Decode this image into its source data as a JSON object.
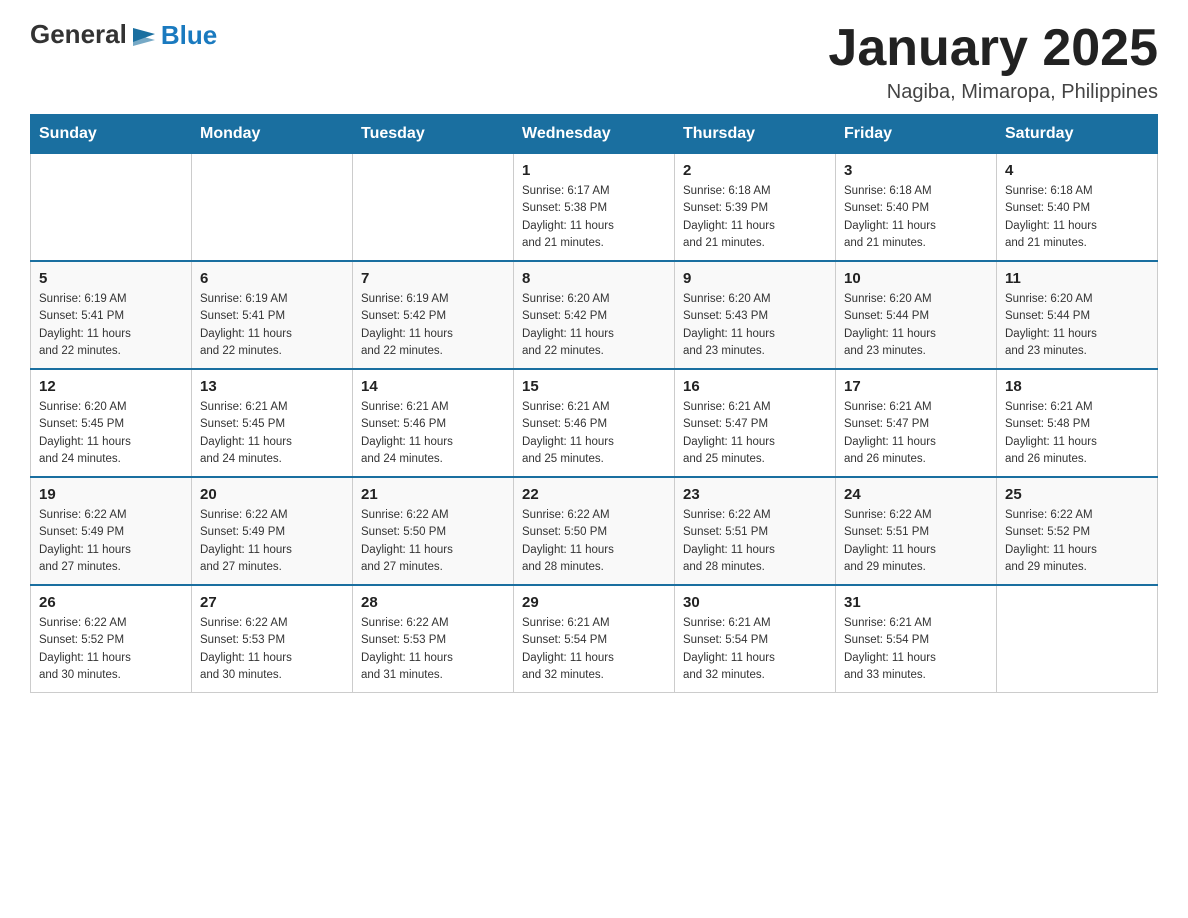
{
  "logo": {
    "text_general": "General",
    "text_blue": "Blue",
    "alt": "GeneralBlue logo"
  },
  "title": "January 2025",
  "subtitle": "Nagiba, Mimaropa, Philippines",
  "header_color": "#1a6fa0",
  "days": [
    "Sunday",
    "Monday",
    "Tuesday",
    "Wednesday",
    "Thursday",
    "Friday",
    "Saturday"
  ],
  "weeks": [
    [
      {
        "day": "",
        "info": ""
      },
      {
        "day": "",
        "info": ""
      },
      {
        "day": "",
        "info": ""
      },
      {
        "day": "1",
        "info": "Sunrise: 6:17 AM\nSunset: 5:38 PM\nDaylight: 11 hours\nand 21 minutes."
      },
      {
        "day": "2",
        "info": "Sunrise: 6:18 AM\nSunset: 5:39 PM\nDaylight: 11 hours\nand 21 minutes."
      },
      {
        "day": "3",
        "info": "Sunrise: 6:18 AM\nSunset: 5:40 PM\nDaylight: 11 hours\nand 21 minutes."
      },
      {
        "day": "4",
        "info": "Sunrise: 6:18 AM\nSunset: 5:40 PM\nDaylight: 11 hours\nand 21 minutes."
      }
    ],
    [
      {
        "day": "5",
        "info": "Sunrise: 6:19 AM\nSunset: 5:41 PM\nDaylight: 11 hours\nand 22 minutes."
      },
      {
        "day": "6",
        "info": "Sunrise: 6:19 AM\nSunset: 5:41 PM\nDaylight: 11 hours\nand 22 minutes."
      },
      {
        "day": "7",
        "info": "Sunrise: 6:19 AM\nSunset: 5:42 PM\nDaylight: 11 hours\nand 22 minutes."
      },
      {
        "day": "8",
        "info": "Sunrise: 6:20 AM\nSunset: 5:42 PM\nDaylight: 11 hours\nand 22 minutes."
      },
      {
        "day": "9",
        "info": "Sunrise: 6:20 AM\nSunset: 5:43 PM\nDaylight: 11 hours\nand 23 minutes."
      },
      {
        "day": "10",
        "info": "Sunrise: 6:20 AM\nSunset: 5:44 PM\nDaylight: 11 hours\nand 23 minutes."
      },
      {
        "day": "11",
        "info": "Sunrise: 6:20 AM\nSunset: 5:44 PM\nDaylight: 11 hours\nand 23 minutes."
      }
    ],
    [
      {
        "day": "12",
        "info": "Sunrise: 6:20 AM\nSunset: 5:45 PM\nDaylight: 11 hours\nand 24 minutes."
      },
      {
        "day": "13",
        "info": "Sunrise: 6:21 AM\nSunset: 5:45 PM\nDaylight: 11 hours\nand 24 minutes."
      },
      {
        "day": "14",
        "info": "Sunrise: 6:21 AM\nSunset: 5:46 PM\nDaylight: 11 hours\nand 24 minutes."
      },
      {
        "day": "15",
        "info": "Sunrise: 6:21 AM\nSunset: 5:46 PM\nDaylight: 11 hours\nand 25 minutes."
      },
      {
        "day": "16",
        "info": "Sunrise: 6:21 AM\nSunset: 5:47 PM\nDaylight: 11 hours\nand 25 minutes."
      },
      {
        "day": "17",
        "info": "Sunrise: 6:21 AM\nSunset: 5:47 PM\nDaylight: 11 hours\nand 26 minutes."
      },
      {
        "day": "18",
        "info": "Sunrise: 6:21 AM\nSunset: 5:48 PM\nDaylight: 11 hours\nand 26 minutes."
      }
    ],
    [
      {
        "day": "19",
        "info": "Sunrise: 6:22 AM\nSunset: 5:49 PM\nDaylight: 11 hours\nand 27 minutes."
      },
      {
        "day": "20",
        "info": "Sunrise: 6:22 AM\nSunset: 5:49 PM\nDaylight: 11 hours\nand 27 minutes."
      },
      {
        "day": "21",
        "info": "Sunrise: 6:22 AM\nSunset: 5:50 PM\nDaylight: 11 hours\nand 27 minutes."
      },
      {
        "day": "22",
        "info": "Sunrise: 6:22 AM\nSunset: 5:50 PM\nDaylight: 11 hours\nand 28 minutes."
      },
      {
        "day": "23",
        "info": "Sunrise: 6:22 AM\nSunset: 5:51 PM\nDaylight: 11 hours\nand 28 minutes."
      },
      {
        "day": "24",
        "info": "Sunrise: 6:22 AM\nSunset: 5:51 PM\nDaylight: 11 hours\nand 29 minutes."
      },
      {
        "day": "25",
        "info": "Sunrise: 6:22 AM\nSunset: 5:52 PM\nDaylight: 11 hours\nand 29 minutes."
      }
    ],
    [
      {
        "day": "26",
        "info": "Sunrise: 6:22 AM\nSunset: 5:52 PM\nDaylight: 11 hours\nand 30 minutes."
      },
      {
        "day": "27",
        "info": "Sunrise: 6:22 AM\nSunset: 5:53 PM\nDaylight: 11 hours\nand 30 minutes."
      },
      {
        "day": "28",
        "info": "Sunrise: 6:22 AM\nSunset: 5:53 PM\nDaylight: 11 hours\nand 31 minutes."
      },
      {
        "day": "29",
        "info": "Sunrise: 6:21 AM\nSunset: 5:54 PM\nDaylight: 11 hours\nand 32 minutes."
      },
      {
        "day": "30",
        "info": "Sunrise: 6:21 AM\nSunset: 5:54 PM\nDaylight: 11 hours\nand 32 minutes."
      },
      {
        "day": "31",
        "info": "Sunrise: 6:21 AM\nSunset: 5:54 PM\nDaylight: 11 hours\nand 33 minutes."
      },
      {
        "day": "",
        "info": ""
      }
    ]
  ]
}
